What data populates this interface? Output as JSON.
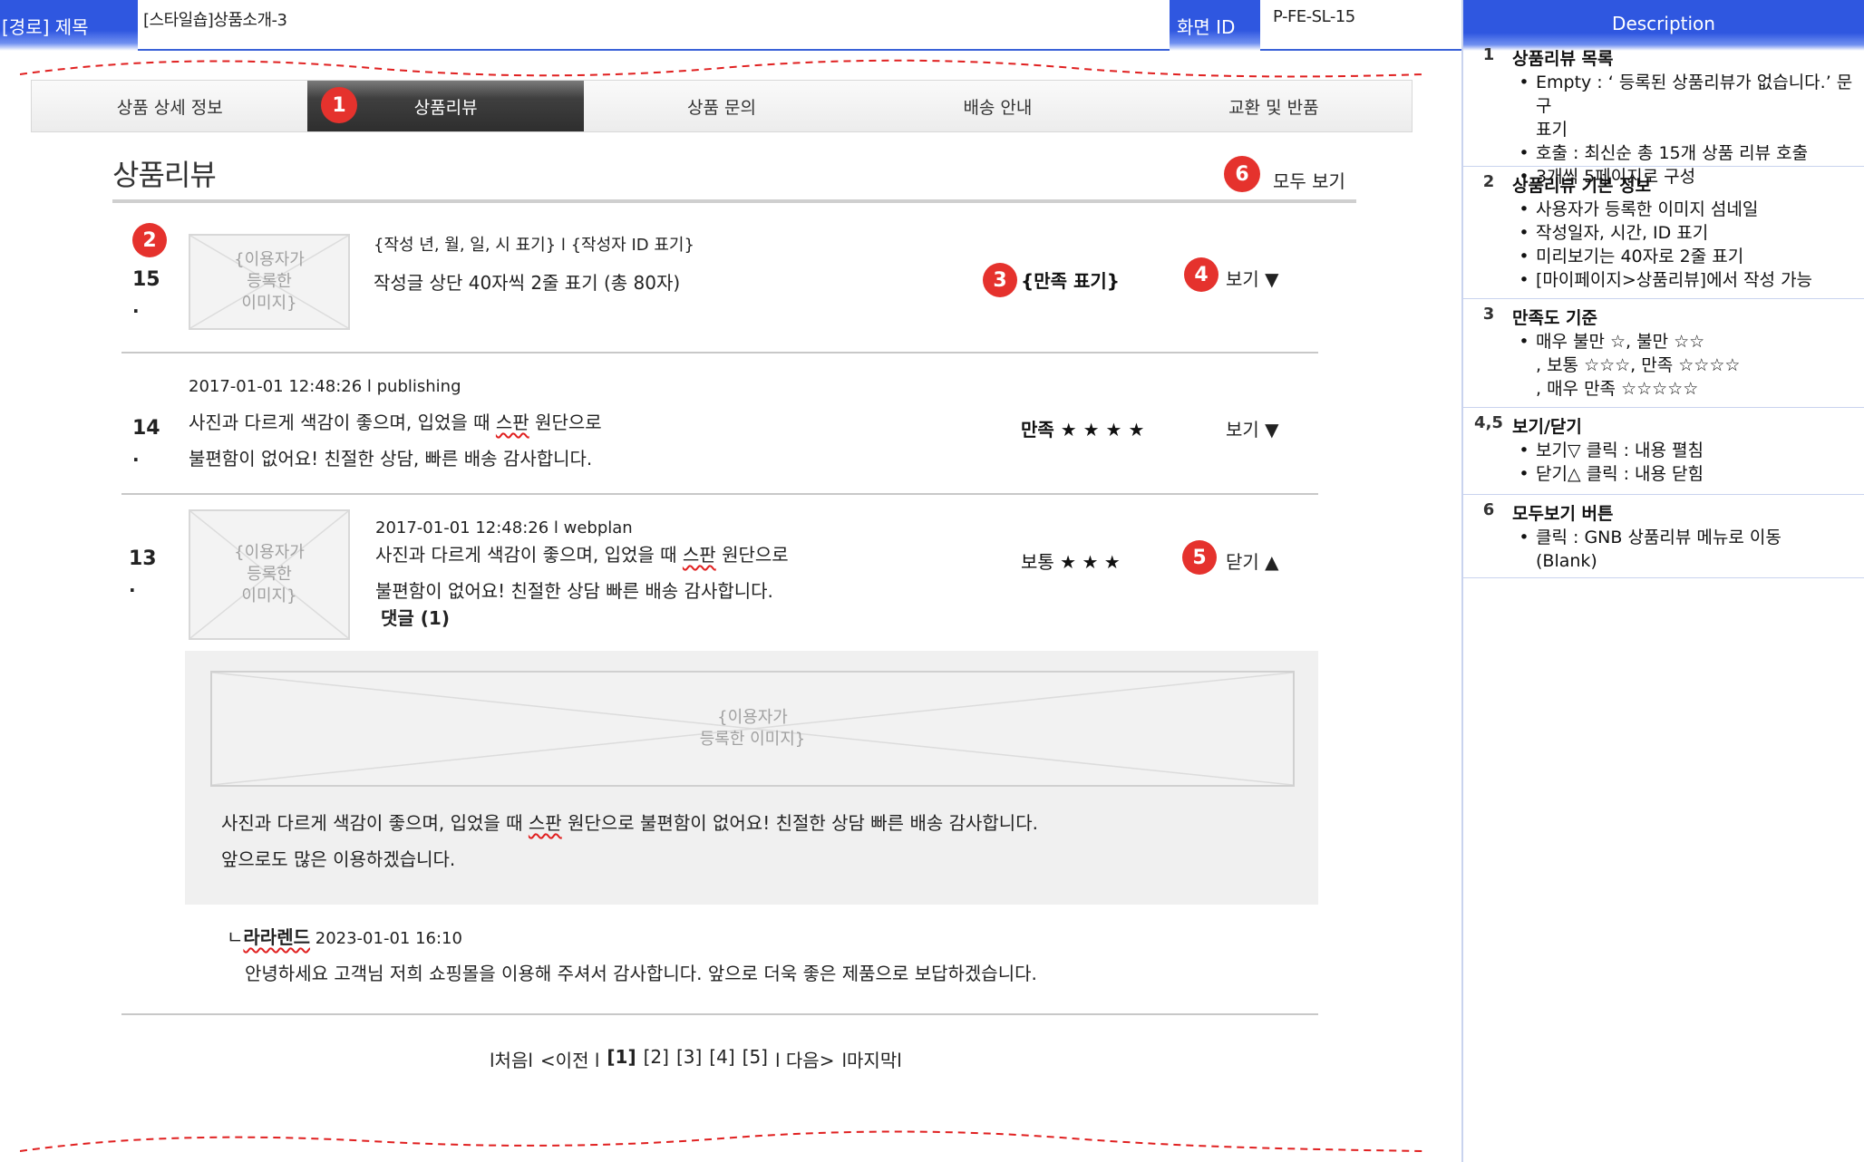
{
  "header": {
    "path_label": "[경로] 제목",
    "title": "[스타일숍]상품소개-3",
    "screen_id_label": "화면 ID",
    "screen_id": "P-FE-SL-15"
  },
  "tabs": [
    {
      "label": "상품 상세 정보"
    },
    {
      "label": "상품리뷰"
    },
    {
      "label": "상품 문의"
    },
    {
      "label": "배송 안내"
    },
    {
      "label": "교환 및 반품"
    }
  ],
  "markers": [
    "1",
    "2",
    "3",
    "4",
    "5",
    "6"
  ],
  "section": {
    "title": "상품리뷰",
    "view_all": "모두 보기"
  },
  "reviews": [
    {
      "number": "15",
      "dot": ".",
      "image_placeholder": "{이용자가\n등록한\n이미지}",
      "meta": "{작성 년, 월, 일, 시 표기} l  {작성자 ID 표기}",
      "line1": "작성글 상단 40자씩 2줄 표기 (총 80자)",
      "satisfaction": "{만족 표기}",
      "toggle": "보기 ▼"
    },
    {
      "number": "14",
      "dot": ".",
      "meta": "2017-01-01  12:48:26 l publishing",
      "line1_a": "사진과 다르게 색감이 좋으며, 입었을 때 ",
      "line1_b": "스판",
      "line1_c": " 원단으로",
      "line2": "불편함이 없어요! 친절한 상담, 빠른 배송 감사합니다.",
      "satisfaction": "만족 ★ ★ ★ ★",
      "toggle": "보기 ▼"
    },
    {
      "number": "13",
      "dot": ".",
      "image_placeholder": "{이용자가\n등록한\n이미지}",
      "meta": "2017-01-01    12:48:26 l   webplan",
      "line1_a": "사진과 다르게 색감이 좋으며, 입었을 때 ",
      "line1_b": "스판",
      "line1_c": " 원단으로",
      "line2": "불편함이 없어요! 친절한 상담 빠른 배송 감사합니다.",
      "comments": "댓글 (1)",
      "satisfaction": "보통 ★ ★ ★",
      "toggle": "닫기 ▲",
      "expanded": {
        "image_placeholder": "{이용자가\n등록한 이미지}",
        "body1_a": "사진과 다르게 색감이 좋으며, 입었을 때 ",
        "body1_b": "스판",
        "body1_c": " 원단으로 불편함이 없어요! 친절한 상담 빠른 배송 감사합니다.",
        "body2": "앞으로도 많은 이용하겠습니다."
      },
      "reply": {
        "prefix": "ㄴ",
        "author": "라라렌드",
        "datetime": " 2023-01-01 16:10",
        "text": "안녕하세요 고객님 저희 쇼핑몰을 이용해 주셔서 감사합니다. 앞으로 더욱 좋은 제품으로 보답하겠습니다."
      }
    }
  ],
  "pagination": {
    "first": "l처음l",
    "prev": "<이전 l",
    "pages": [
      "[1]",
      "[2]",
      "[3]",
      "[4]",
      "[5]"
    ],
    "next": "l 다음>",
    "last": "l마지막l"
  },
  "description": {
    "heading": "Description",
    "sections": [
      {
        "no": "1",
        "title": "상품리뷰 목록",
        "items": [
          {
            "type": "bullet",
            "text": "Empty : ‘ 등록된 상품리뷰가 없습니다.’ 문구"
          },
          {
            "type": "cont",
            "text": "표기"
          },
          {
            "type": "bullet",
            "text": "호출 : 최신순 총 15개 상품 리뷰 호출"
          },
          {
            "type": "bullet",
            "text": "3개씩 5페이지로 구성"
          }
        ]
      },
      {
        "no": "2",
        "title": "상품리뷰 기본 정보",
        "items": [
          {
            "type": "bullet",
            "text": "사용자가 등록한 이미지 섬네일"
          },
          {
            "type": "bullet",
            "text": "작성일자, 시간, ID 표기"
          },
          {
            "type": "bullet",
            "text": "미리보기는 40자로 2줄 표기"
          },
          {
            "type": "bullet",
            "text": "[마이페이지>상품리뷰]에서 작성 가능"
          }
        ]
      },
      {
        "no": "3",
        "title": "만족도 기준",
        "items": [
          {
            "type": "bullet",
            "text": "매우 불만 ☆, 불만 ☆☆"
          },
          {
            "type": "cont",
            "text": ", 보통 ☆☆☆, 만족 ☆☆☆☆"
          },
          {
            "type": "cont",
            "text": ", 매우 만족 ☆☆☆☆☆"
          }
        ]
      },
      {
        "no": "4,5",
        "title": "보기/닫기",
        "items": [
          {
            "type": "bullet",
            "text": "보기▽ 클릭 : 내용 펼침"
          },
          {
            "type": "bullet",
            "text": "닫기△ 클릭 : 내용 닫힘"
          }
        ]
      },
      {
        "no": "6",
        "title": "모두보기 버튼",
        "items": [
          {
            "type": "bullet",
            "text": "클릭 : GNB 상품리뷰 메뉴로 이동"
          },
          {
            "type": "cont",
            "text": "(Blank)"
          }
        ]
      }
    ]
  },
  "colors": {
    "header_blue": "#2f57e0",
    "marker_red": "#e5322d",
    "active_tab": "#3a3a3a",
    "cut_line": "#e02020"
  }
}
